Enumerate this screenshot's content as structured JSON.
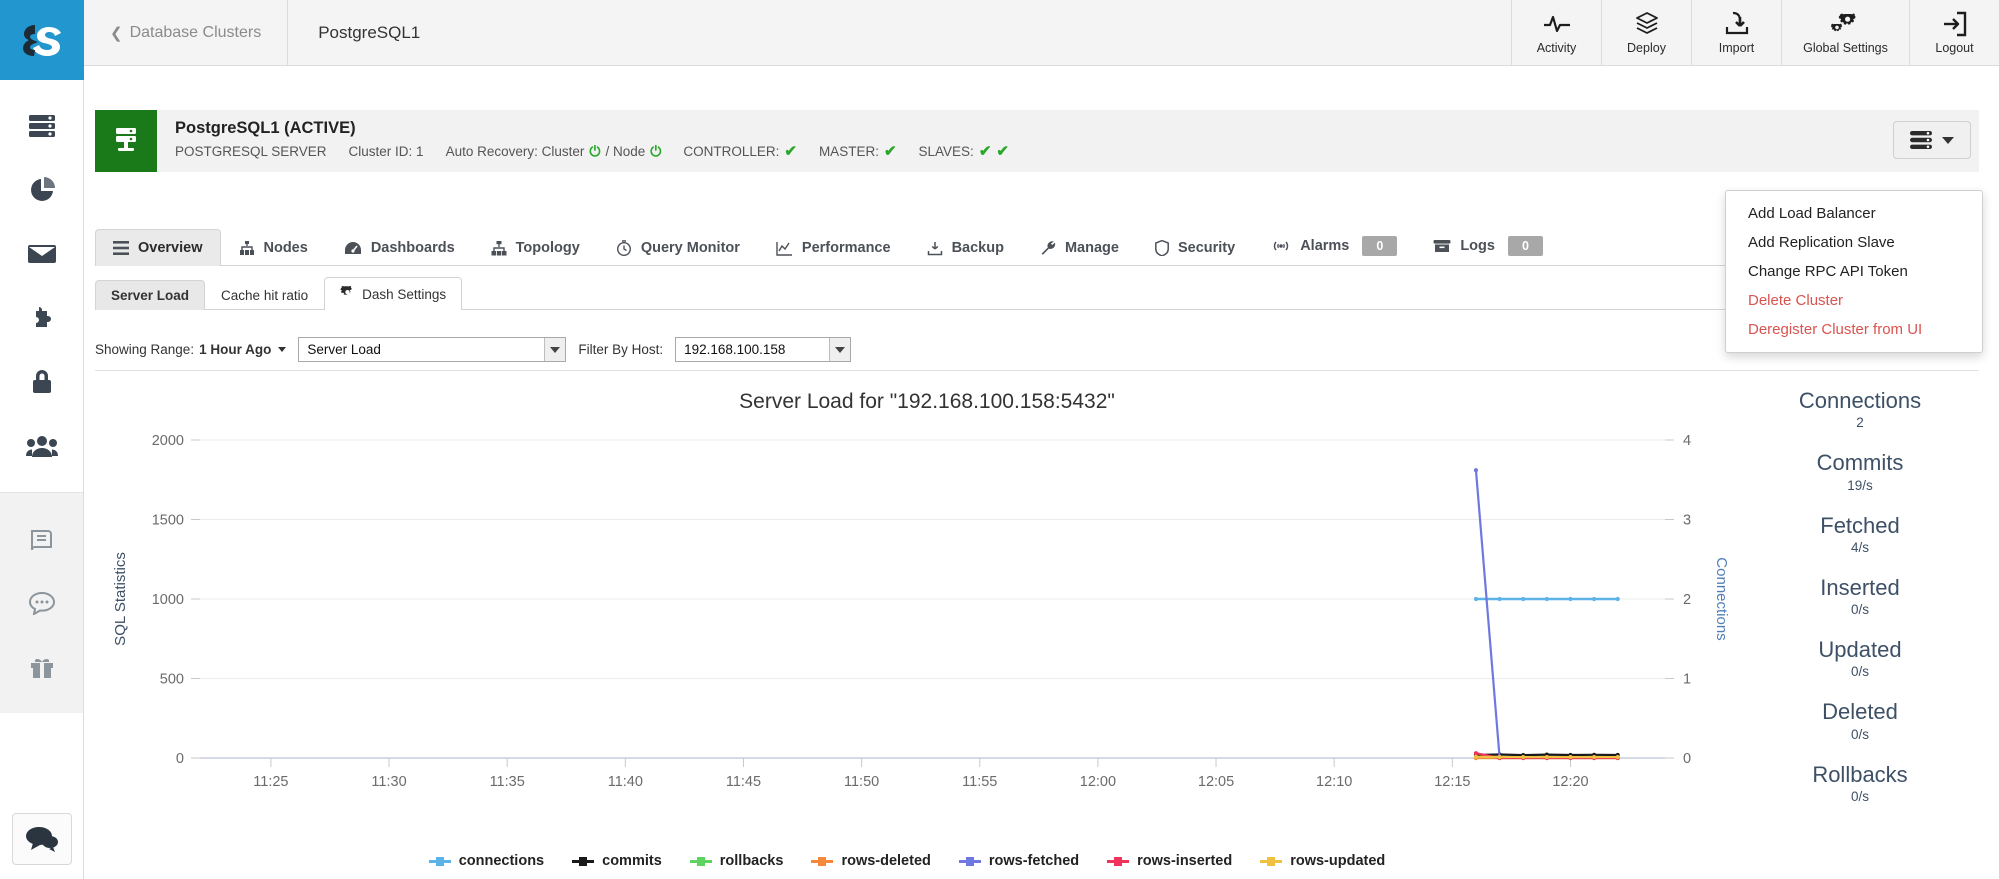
{
  "topbar": {
    "back_label": "Database Clusters",
    "back_icon": "chevron-left-icon",
    "current_label": "PostgreSQL1",
    "nav": [
      {
        "label": "Activity",
        "icon": "activity-pulse-icon"
      },
      {
        "label": "Deploy",
        "icon": "layers-cube-icon"
      },
      {
        "label": "Import",
        "icon": "import-download-icon"
      },
      {
        "label": "Global Settings",
        "icon": "gears-icon"
      },
      {
        "label": "Logout",
        "icon": "logout-arrow-icon"
      }
    ]
  },
  "sidebar": {
    "items": [
      {
        "icon": "database-servers-icon",
        "name": "clusters"
      },
      {
        "icon": "pie-chart-icon",
        "name": "reports"
      },
      {
        "icon": "envelope-icon",
        "name": "mail"
      },
      {
        "icon": "puzzle-piece-icon",
        "name": "integrations"
      },
      {
        "icon": "lock-icon",
        "name": "key-management"
      },
      {
        "icon": "users-group-icon",
        "name": "users"
      }
    ],
    "secondary_items": [
      {
        "icon": "book-icon",
        "name": "docs"
      },
      {
        "icon": "speech-bubble-icon",
        "name": "support"
      },
      {
        "icon": "gift-icon",
        "name": "whats-new"
      }
    ],
    "chat_icon": "chat-bubbles-icon"
  },
  "cluster": {
    "badge_icon": "database-server-icon",
    "badge_color": "#1a7a1a",
    "title": "PostgreSQL1 (ACTIVE)",
    "type": "POSTGRESQL SERVER",
    "cluster_id_label": "Cluster ID: 1",
    "auto_recovery_label": "Auto Recovery: Cluster",
    "auto_recovery_sep": "/ Node",
    "controller_label": "CONTROLLER:",
    "master_label": "MASTER:",
    "slaves_label": "SLAVES:",
    "check_glyph": "✔",
    "power_glyph": "⏻",
    "actions_icon": "list-lines-icon"
  },
  "cluster_menu": {
    "items": [
      {
        "label": "Add Load Balancer",
        "danger": false
      },
      {
        "label": "Add Replication Slave",
        "danger": false
      },
      {
        "label": "Change RPC API Token",
        "danger": false
      },
      {
        "label": "Delete Cluster",
        "danger": true
      },
      {
        "label": "Deregister Cluster from UI",
        "danger": true
      }
    ]
  },
  "main_tabs": [
    {
      "label": "Overview",
      "icon": "list-bars-icon",
      "active": true
    },
    {
      "label": "Nodes",
      "icon": "nodes-tree-icon",
      "active": false
    },
    {
      "label": "Dashboards",
      "icon": "gauge-icon",
      "active": false
    },
    {
      "label": "Topology",
      "icon": "topology-icon",
      "active": false
    },
    {
      "label": "Query Monitor",
      "icon": "clock-icon",
      "active": false
    },
    {
      "label": "Performance",
      "icon": "line-chart-icon",
      "active": false
    },
    {
      "label": "Backup",
      "icon": "backup-save-icon",
      "active": false
    },
    {
      "label": "Manage",
      "icon": "wrench-icon",
      "active": false
    },
    {
      "label": "Security",
      "icon": "shield-icon",
      "active": false
    },
    {
      "label": "Alarms",
      "icon": "broadcast-icon",
      "active": false,
      "badge": "0"
    },
    {
      "label": "Logs",
      "icon": "logs-archive-icon",
      "active": false,
      "badge": "0"
    }
  ],
  "sub_tabs": [
    {
      "label": "Server Load",
      "state": "active-grey",
      "icon": null
    },
    {
      "label": "Cache hit ratio",
      "state": "plain",
      "icon": null
    },
    {
      "label": "Dash Settings",
      "state": "active-white",
      "icon": "gear-icon"
    }
  ],
  "filter_bar": {
    "range_prefix": "Showing Range:",
    "range_value": "1 Hour Ago",
    "chart_select_value": "Server Load",
    "host_label": "Filter By Host:",
    "host_select_value": "192.168.100.158"
  },
  "stats": [
    {
      "name": "Connections",
      "value": "2"
    },
    {
      "name": "Commits",
      "value": "19/s"
    },
    {
      "name": "Fetched",
      "value": "4/s"
    },
    {
      "name": "Inserted",
      "value": "0/s"
    },
    {
      "name": "Updated",
      "value": "0/s"
    },
    {
      "name": "Deleted",
      "value": "0/s"
    },
    {
      "name": "Rollbacks",
      "value": "0/s"
    }
  ],
  "chart_data": {
    "type": "line",
    "title": "Server Load for \"192.168.100.158:5432\"",
    "xlabel": "",
    "ylabel": "SQL Statistics",
    "y2label": "Connections",
    "grid": true,
    "legend_position": "bottom",
    "ylim": [
      0,
      2000
    ],
    "yticks": [
      0,
      500,
      1000,
      1500,
      2000
    ],
    "y2lim": [
      0,
      4
    ],
    "y2ticks": [
      0,
      1,
      2,
      3,
      4
    ],
    "xticks": [
      "11:25",
      "11:30",
      "11:35",
      "11:40",
      "11:45",
      "11:50",
      "11:55",
      "12:00",
      "12:05",
      "12:10",
      "12:15",
      "12:20"
    ],
    "xlim": [
      "11:22",
      "12:24"
    ],
    "series": [
      {
        "name": "connections",
        "color": "#5bb3e8",
        "axis": "y2",
        "x": [
          "12:16",
          "12:17",
          "12:18",
          "12:19",
          "12:20",
          "12:21",
          "12:22"
        ],
        "values": [
          2,
          2,
          2,
          2,
          2,
          2,
          2
        ]
      },
      {
        "name": "commits",
        "color": "#1a1a1a",
        "axis": "y",
        "x": [
          "12:16",
          "12:17",
          "12:18",
          "12:19",
          "12:20",
          "12:21",
          "12:22"
        ],
        "values": [
          19,
          22,
          18,
          21,
          19,
          20,
          19
        ]
      },
      {
        "name": "rollbacks",
        "color": "#5fd35f",
        "axis": "y",
        "x": [
          "12:16",
          "12:17",
          "12:18",
          "12:19",
          "12:20",
          "12:21",
          "12:22"
        ],
        "values": [
          0,
          0,
          0,
          0,
          0,
          0,
          0
        ]
      },
      {
        "name": "rows-deleted",
        "color": "#f5883c",
        "axis": "y",
        "x": [
          "12:16",
          "12:17",
          "12:18",
          "12:19",
          "12:20",
          "12:21",
          "12:22"
        ],
        "values": [
          0,
          0,
          0,
          0,
          0,
          0,
          0
        ]
      },
      {
        "name": "rows-fetched",
        "color": "#6f78e0",
        "axis": "y",
        "x": [
          "12:16",
          "12:17",
          "12:18",
          "12:19",
          "12:20",
          "12:21",
          "12:22"
        ],
        "values": [
          1810,
          4,
          4,
          4,
          4,
          4,
          4
        ]
      },
      {
        "name": "rows-inserted",
        "color": "#f0325c",
        "axis": "y",
        "x": [
          "12:16",
          "12:17",
          "12:18",
          "12:19",
          "12:20",
          "12:21",
          "12:22"
        ],
        "values": [
          30,
          0,
          0,
          0,
          0,
          0,
          0
        ]
      },
      {
        "name": "rows-updated",
        "color": "#f0c040",
        "axis": "y",
        "x": [
          "12:16",
          "12:17",
          "12:18",
          "12:19",
          "12:20",
          "12:21",
          "12:22"
        ],
        "values": [
          8,
          6,
          6,
          6,
          6,
          6,
          6
        ]
      }
    ]
  }
}
